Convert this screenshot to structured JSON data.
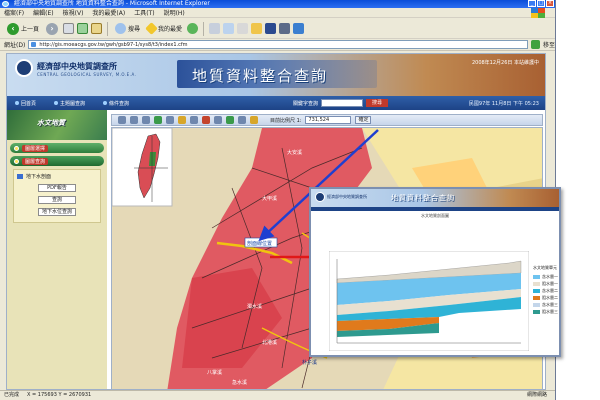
{
  "window": {
    "title": "經濟部中央地質調查所 地質資料整合查詢 - Microsoft Internet Explorer"
  },
  "menu": [
    "檔案(F)",
    "編輯(E)",
    "檢視(V)",
    "我的最愛(A)",
    "工具(T)",
    "說明(H)"
  ],
  "toolbar": {
    "back_label": "上一頁",
    "search_label": "搜尋",
    "favorites_label": "我的最愛"
  },
  "address": {
    "label": "網址(D)",
    "url": "http://gis.moeacgs.gov.tw/gwh/gsb97-1/sys8/t3/index1.cfm",
    "go_label": "移至"
  },
  "site": {
    "org_name": "經濟部中央地質調查所",
    "org_name_en": "CENTRAL GEOLOGICAL SURVEY, M.O.E.A.",
    "title": "地質資料整合查詢",
    "header_date": "2008年12月26日 本站維護中"
  },
  "nav": {
    "items": [
      "回首頁",
      "主題圖查詢",
      "條件查詢"
    ],
    "search_label": "關鍵字查詢",
    "search_button": "搜尋",
    "datetime": "民國97年 11月8日 下午 05:23"
  },
  "left_panel": {
    "banner": "水文地質",
    "tabs": [
      "圖層選擇",
      "圖層查詢"
    ],
    "subpanel_title": "地下水剖面",
    "buttons": [
      "PDF報告",
      "查詢",
      "地下水位查詢"
    ]
  },
  "map_toolbar": {
    "scale_label": "目前比例尺 1:",
    "scale_value": "731,524",
    "scale_button": "確定"
  },
  "map": {
    "labels": [
      "大安溪",
      "大甲溪",
      "烏溪",
      "濁水溪",
      "北港溪",
      "朴子溪",
      "八掌溪",
      "急水溪"
    ],
    "profile_label": "剖面線位置"
  },
  "popup": {
    "org": "經濟部中央地質調查所",
    "title": "地質資料整合查詢",
    "plot_title": "水文地質剖面圖",
    "legend_title": "水文地質單元",
    "legend_items": [
      "含水層一",
      "阻水層一",
      "含水層二",
      "阻水層二",
      "含水層三",
      "阻水層三"
    ],
    "legend_colors": [
      "#6ec3ef",
      "#e8e0d0",
      "#2fb3d6",
      "#e07a1c",
      "#c4d6ea",
      "#2e9a8f"
    ]
  },
  "statusbar": {
    "left": "已完成",
    "coords": "X = 175693   Y = 2670931",
    "zone": "網際網路"
  }
}
